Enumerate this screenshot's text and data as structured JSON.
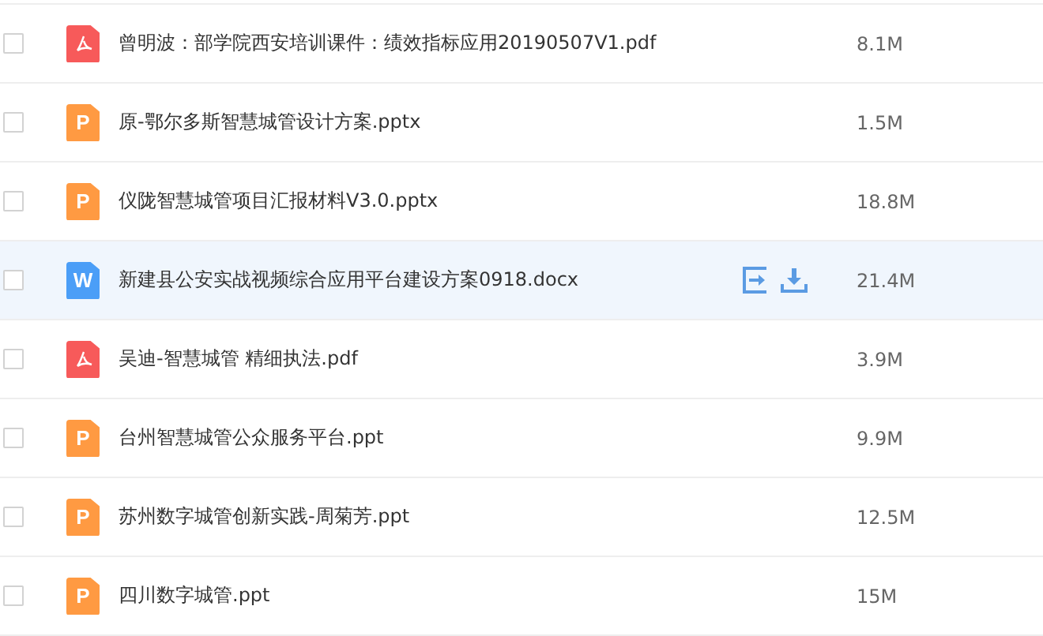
{
  "files": [
    {
      "name": "曾明波：部学院西安培训课件：绩效指标应用20190507V1.pdf",
      "size": "8.1M",
      "kind": "pdf",
      "checked": false,
      "hovered": false
    },
    {
      "name": "原-鄂尔多斯智慧城管设计方案.pptx",
      "size": "1.5M",
      "kind": "ppt",
      "icon_letter": "P",
      "checked": false,
      "hovered": false
    },
    {
      "name": "仪陇智慧城管项目汇报材料V3.0.pptx",
      "size": "18.8M",
      "kind": "ppt",
      "icon_letter": "P",
      "checked": false,
      "hovered": false
    },
    {
      "name": "新建县公安实战视频综合应用平台建设方案0918.docx",
      "size": "21.4M",
      "kind": "word",
      "icon_letter": "W",
      "checked": false,
      "hovered": true
    },
    {
      "name": "吴迪-智慧城管 精细执法.pdf",
      "size": "3.9M",
      "kind": "pdf",
      "checked": false,
      "hovered": false
    },
    {
      "name": "台州智慧城管公众服务平台.ppt",
      "size": "9.9M",
      "kind": "ppt",
      "icon_letter": "P",
      "checked": false,
      "hovered": false
    },
    {
      "name": "苏州数字城管创新实践-周菊芳.ppt",
      "size": "12.5M",
      "kind": "ppt",
      "icon_letter": "P",
      "checked": false,
      "hovered": false
    },
    {
      "name": "四川数字城管.ppt",
      "size": "15M",
      "kind": "ppt",
      "icon_letter": "P",
      "checked": false,
      "hovered": false
    }
  ]
}
